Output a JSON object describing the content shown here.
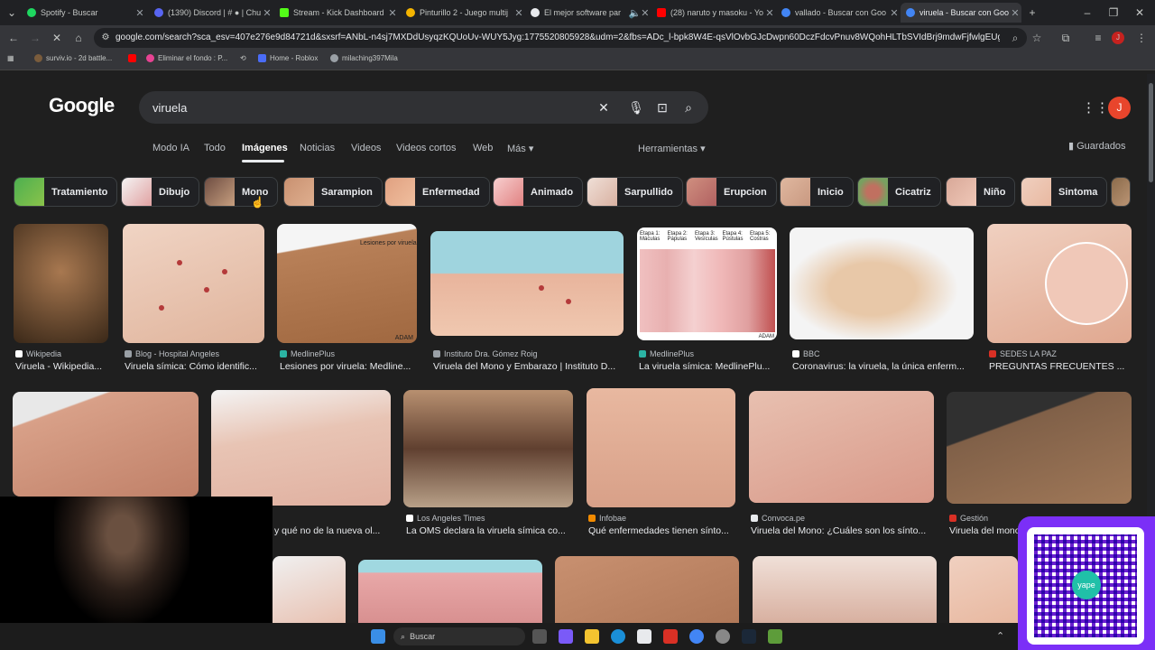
{
  "tabs": [
    {
      "title": "Spotify - Buscar",
      "color": "#1ed760"
    },
    {
      "title": "(1390) Discord | # ● | Chu",
      "color": "#5865f2"
    },
    {
      "title": "Stream - Kick Dashboard",
      "color": "#53fc18"
    },
    {
      "title": "Pinturillo 2 - Juego multij",
      "color": "#f4b400"
    },
    {
      "title": "El mejor software par",
      "color": "#e8eaed"
    },
    {
      "title": "(28) naruto y masoku - Yo",
      "color": "#ff0000"
    },
    {
      "title": "vallado - Buscar con Goo",
      "color": "#4285f4"
    },
    {
      "title": "viruela - Buscar con Goog",
      "color": "#4285f4"
    }
  ],
  "url": "google.com/search?sca_esv=407e276e9d84721d&sxsrf=ANbL-n4sj7MXDdUsyqzKQUoUv-WUY5Jyg:1775520805928&udm=2&fbs=ADc_l-bpk8W4E-qsVlOvbGJcDwpn60DczFdcvPnuv8WQohHLTbSVIdBrj9mdwFjfwlgEUgS3rVmfuCXEBMRJM...",
  "bookmarks": [
    "surviv.io - 2d battle...",
    "Eliminar el fondo : P...",
    "Home - Roblox",
    "milaching397Mila"
  ],
  "google": {
    "logo": "Google",
    "query": "viruela",
    "nav": [
      "Modo IA",
      "Todo",
      "Imágenes",
      "Noticias",
      "Videos",
      "Videos cortos",
      "Web",
      "Más",
      "Herramientas"
    ],
    "saved": "Guardados",
    "avatar": "J"
  },
  "chips": [
    "Tratamiento",
    "Dibujo",
    "Mono",
    "Sarampion",
    "Enfermedad",
    "Animado",
    "Sarpullido",
    "Erupcion",
    "Inicio",
    "Cicatriz",
    "Niño",
    "Sintoma"
  ],
  "row1": [
    {
      "source": "Wikipedia",
      "caption": "Viruela - Wikipedia..."
    },
    {
      "source": "Blog - Hospital Angeles",
      "caption": "Viruela símica: Cómo identific..."
    },
    {
      "source": "MedlinePlus",
      "caption": "Lesiones por viruela: Medline..."
    },
    {
      "source": "Instituto Dra. Gómez Roig",
      "caption": "Viruela del Mono y Embarazo | Instituto D..."
    },
    {
      "source": "MedlinePlus",
      "caption": "La viruela símica: MedlinePlu..."
    },
    {
      "source": "BBC",
      "caption": "Coronavirus: la viruela, la única enferm..."
    },
    {
      "source": "SEDES LA PAZ",
      "caption": "PREGUNTAS FRECUENTES ..."
    }
  ],
  "row2": [
    {
      "source": "",
      "caption": ""
    },
    {
      "source": "",
      "caption": "y qué no de la nueva ol..."
    },
    {
      "source": "Los Angeles Times",
      "caption": "La OMS declara la viruela símica co..."
    },
    {
      "source": "Infobae",
      "caption": "Qué enfermedades tienen sínto..."
    },
    {
      "source": "Convoca.pe",
      "caption": "Viruela del Mono: ¿Cuáles son los sínto..."
    },
    {
      "source": "Gestión",
      "caption": "Viruela del mono"
    }
  ],
  "labels": {
    "medline_figure": "Lesiones por viruela",
    "stages": [
      "Etapa 1: Máculas",
      "Etapa 2: Pápulas",
      "Etapa 3: Vesículas",
      "Etapa 4: Pústulas",
      "Etapa 5: Costras"
    ],
    "adam": "ADAM"
  },
  "taskbar": {
    "search": "Buscar"
  },
  "qr_brand": "yape"
}
